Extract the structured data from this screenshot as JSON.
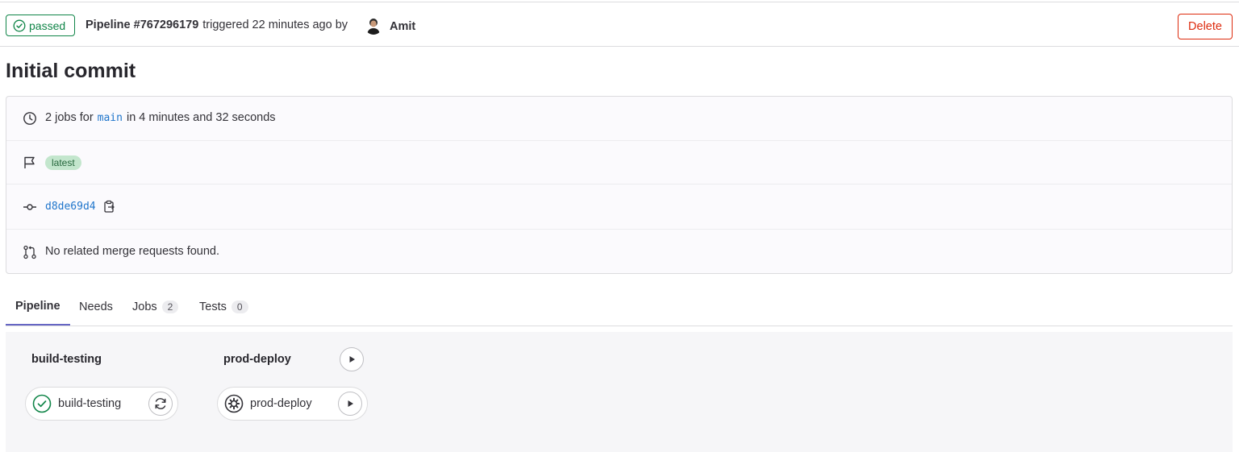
{
  "header": {
    "status": "passed",
    "pipeline_label": "Pipeline #767296179",
    "triggered_text": "triggered 22 minutes ago by",
    "author": "Amit",
    "delete_label": "Delete",
    "status_color": "#108548",
    "danger_color": "#dd2b0e"
  },
  "title": "Initial commit",
  "info": {
    "jobs_prefix": "2 jobs for",
    "branch": "main",
    "duration": "in 4 minutes and 32 seconds",
    "label": "latest",
    "commit_sha": "d8de69d4",
    "merge_requests": "No related merge requests found.",
    "icons": [
      "clock-icon",
      "flag-icon",
      "commit-icon",
      "copy-icon",
      "merge-request-icon"
    ]
  },
  "tabs": [
    {
      "label": "Pipeline",
      "active": true
    },
    {
      "label": "Needs"
    },
    {
      "label": "Jobs",
      "count": "2"
    },
    {
      "label": "Tests",
      "count": "0"
    }
  ],
  "pipeline": {
    "stages": [
      {
        "title": "build-testing",
        "job": "build-testing",
        "job_status": "success",
        "action_icon": "retry-icon"
      },
      {
        "title": "prod-deploy",
        "job": "prod-deploy",
        "job_status": "manual",
        "action_icon": "play-icon"
      }
    ],
    "accent_color": "#6666c4"
  }
}
